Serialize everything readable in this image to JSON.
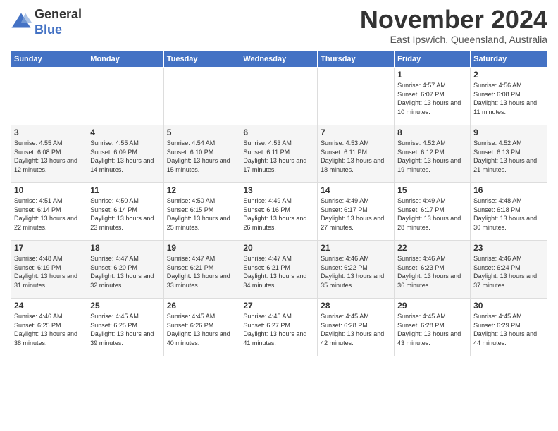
{
  "header": {
    "logo_general": "General",
    "logo_blue": "Blue",
    "month_title": "November 2024",
    "location": "East Ipswich, Queensland, Australia"
  },
  "days_of_week": [
    "Sunday",
    "Monday",
    "Tuesday",
    "Wednesday",
    "Thursday",
    "Friday",
    "Saturday"
  ],
  "weeks": [
    [
      {
        "day": "",
        "info": ""
      },
      {
        "day": "",
        "info": ""
      },
      {
        "day": "",
        "info": ""
      },
      {
        "day": "",
        "info": ""
      },
      {
        "day": "",
        "info": ""
      },
      {
        "day": "1",
        "info": "Sunrise: 4:57 AM\nSunset: 6:07 PM\nDaylight: 13 hours and 10 minutes."
      },
      {
        "day": "2",
        "info": "Sunrise: 4:56 AM\nSunset: 6:08 PM\nDaylight: 13 hours and 11 minutes."
      }
    ],
    [
      {
        "day": "3",
        "info": "Sunrise: 4:55 AM\nSunset: 6:08 PM\nDaylight: 13 hours and 12 minutes."
      },
      {
        "day": "4",
        "info": "Sunrise: 4:55 AM\nSunset: 6:09 PM\nDaylight: 13 hours and 14 minutes."
      },
      {
        "day": "5",
        "info": "Sunrise: 4:54 AM\nSunset: 6:10 PM\nDaylight: 13 hours and 15 minutes."
      },
      {
        "day": "6",
        "info": "Sunrise: 4:53 AM\nSunset: 6:11 PM\nDaylight: 13 hours and 17 minutes."
      },
      {
        "day": "7",
        "info": "Sunrise: 4:53 AM\nSunset: 6:11 PM\nDaylight: 13 hours and 18 minutes."
      },
      {
        "day": "8",
        "info": "Sunrise: 4:52 AM\nSunset: 6:12 PM\nDaylight: 13 hours and 19 minutes."
      },
      {
        "day": "9",
        "info": "Sunrise: 4:52 AM\nSunset: 6:13 PM\nDaylight: 13 hours and 21 minutes."
      }
    ],
    [
      {
        "day": "10",
        "info": "Sunrise: 4:51 AM\nSunset: 6:14 PM\nDaylight: 13 hours and 22 minutes."
      },
      {
        "day": "11",
        "info": "Sunrise: 4:50 AM\nSunset: 6:14 PM\nDaylight: 13 hours and 23 minutes."
      },
      {
        "day": "12",
        "info": "Sunrise: 4:50 AM\nSunset: 6:15 PM\nDaylight: 13 hours and 25 minutes."
      },
      {
        "day": "13",
        "info": "Sunrise: 4:49 AM\nSunset: 6:16 PM\nDaylight: 13 hours and 26 minutes."
      },
      {
        "day": "14",
        "info": "Sunrise: 4:49 AM\nSunset: 6:17 PM\nDaylight: 13 hours and 27 minutes."
      },
      {
        "day": "15",
        "info": "Sunrise: 4:49 AM\nSunset: 6:17 PM\nDaylight: 13 hours and 28 minutes."
      },
      {
        "day": "16",
        "info": "Sunrise: 4:48 AM\nSunset: 6:18 PM\nDaylight: 13 hours and 30 minutes."
      }
    ],
    [
      {
        "day": "17",
        "info": "Sunrise: 4:48 AM\nSunset: 6:19 PM\nDaylight: 13 hours and 31 minutes."
      },
      {
        "day": "18",
        "info": "Sunrise: 4:47 AM\nSunset: 6:20 PM\nDaylight: 13 hours and 32 minutes."
      },
      {
        "day": "19",
        "info": "Sunrise: 4:47 AM\nSunset: 6:21 PM\nDaylight: 13 hours and 33 minutes."
      },
      {
        "day": "20",
        "info": "Sunrise: 4:47 AM\nSunset: 6:21 PM\nDaylight: 13 hours and 34 minutes."
      },
      {
        "day": "21",
        "info": "Sunrise: 4:46 AM\nSunset: 6:22 PM\nDaylight: 13 hours and 35 minutes."
      },
      {
        "day": "22",
        "info": "Sunrise: 4:46 AM\nSunset: 6:23 PM\nDaylight: 13 hours and 36 minutes."
      },
      {
        "day": "23",
        "info": "Sunrise: 4:46 AM\nSunset: 6:24 PM\nDaylight: 13 hours and 37 minutes."
      }
    ],
    [
      {
        "day": "24",
        "info": "Sunrise: 4:46 AM\nSunset: 6:25 PM\nDaylight: 13 hours and 38 minutes."
      },
      {
        "day": "25",
        "info": "Sunrise: 4:45 AM\nSunset: 6:25 PM\nDaylight: 13 hours and 39 minutes."
      },
      {
        "day": "26",
        "info": "Sunrise: 4:45 AM\nSunset: 6:26 PM\nDaylight: 13 hours and 40 minutes."
      },
      {
        "day": "27",
        "info": "Sunrise: 4:45 AM\nSunset: 6:27 PM\nDaylight: 13 hours and 41 minutes."
      },
      {
        "day": "28",
        "info": "Sunrise: 4:45 AM\nSunset: 6:28 PM\nDaylight: 13 hours and 42 minutes."
      },
      {
        "day": "29",
        "info": "Sunrise: 4:45 AM\nSunset: 6:28 PM\nDaylight: 13 hours and 43 minutes."
      },
      {
        "day": "30",
        "info": "Sunrise: 4:45 AM\nSunset: 6:29 PM\nDaylight: 13 hours and 44 minutes."
      }
    ]
  ]
}
